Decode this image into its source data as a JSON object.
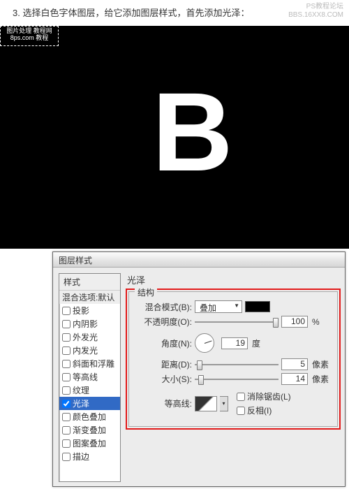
{
  "step_text": "3. 选择白色字体图层，给它添加图层样式，首先添加光泽：",
  "watermark": {
    "line1": "PS教程论坛",
    "line2": "BBS.16XX8.COM"
  },
  "canvas": {
    "selection_label": "图片处理 教程网\n8ps.com 教程",
    "big_letter": "B"
  },
  "dialog": {
    "title": "图层样式",
    "styles_header": "样式",
    "styles": [
      {
        "label": "混合选项:默认",
        "checked": null,
        "selected": false,
        "default": true
      },
      {
        "label": "投影",
        "checked": false,
        "selected": false
      },
      {
        "label": "内阴影",
        "checked": false,
        "selected": false
      },
      {
        "label": "外发光",
        "checked": false,
        "selected": false
      },
      {
        "label": "内发光",
        "checked": false,
        "selected": false
      },
      {
        "label": "斜面和浮雕",
        "checked": false,
        "selected": false
      },
      {
        "label": "等高线",
        "checked": false,
        "selected": false
      },
      {
        "label": "纹理",
        "checked": false,
        "selected": false
      },
      {
        "label": "光泽",
        "checked": true,
        "selected": true
      },
      {
        "label": "颜色叠加",
        "checked": false,
        "selected": false
      },
      {
        "label": "渐变叠加",
        "checked": false,
        "selected": false
      },
      {
        "label": "图案叠加",
        "checked": false,
        "selected": false
      },
      {
        "label": "描边",
        "checked": false,
        "selected": false
      }
    ],
    "panel_title": "光泽",
    "fieldset_legend": "结构",
    "blend_mode": {
      "label": "混合模式(B):",
      "value": "叠加",
      "color": "#000000"
    },
    "opacity": {
      "label": "不透明度(O):",
      "value": "100",
      "unit": "%"
    },
    "angle": {
      "label": "角度(N):",
      "value": "19",
      "unit": "度"
    },
    "distance": {
      "label": "距离(D):",
      "value": "5",
      "unit": "像素"
    },
    "size": {
      "label": "大小(S):",
      "value": "14",
      "unit": "像素"
    },
    "contour": {
      "label": "等高线:",
      "antialias": "消除锯齿(L)",
      "invert": "反相(I)"
    }
  }
}
